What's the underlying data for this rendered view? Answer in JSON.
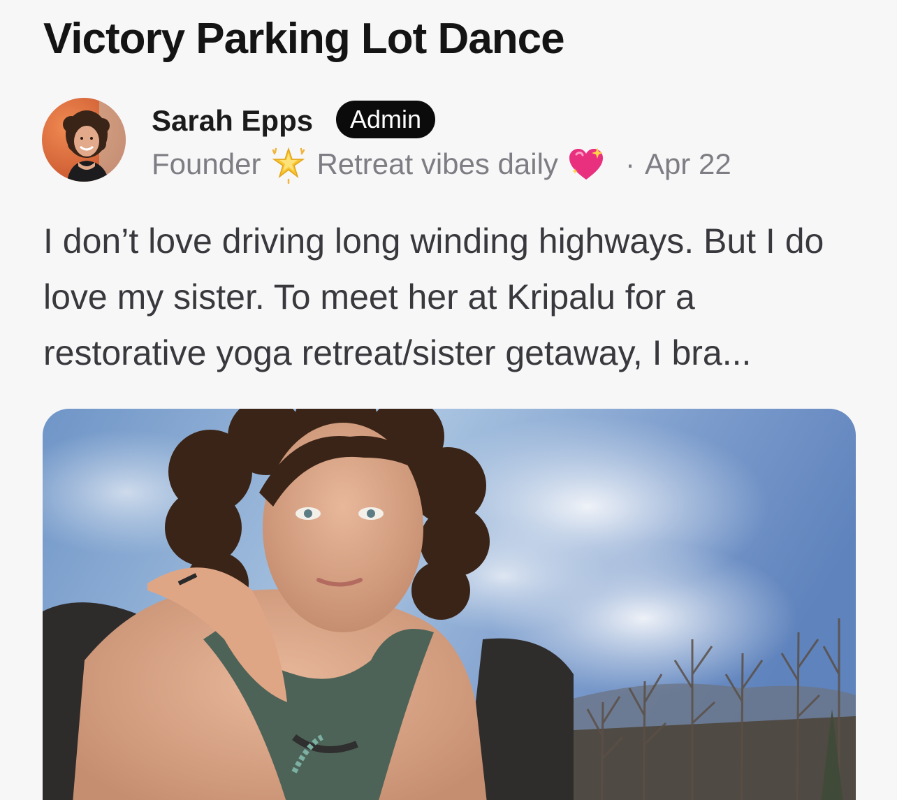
{
  "post": {
    "title": "Victory Parking Lot Dance",
    "author": {
      "name": "Sarah Epps",
      "badge": "Admin",
      "role": "Founder",
      "role_icon": "sparkle-star-icon",
      "tagline": "Retreat vibes daily",
      "tagline_icon": "sparkling-heart-icon",
      "separator": "·",
      "date": "Apr 22"
    },
    "excerpt": "I don’t love driving long winding highways. But I do love my sister. To meet her at Kripalu for a restorative yoga retreat/sister getaway, I bra...",
    "photo_icon": "post-photo",
    "colors": {
      "badge_bg": "#0b0b0b",
      "meta_text": "#7d7d83",
      "body_text": "#38383d",
      "background": "#f7f7f8"
    }
  }
}
